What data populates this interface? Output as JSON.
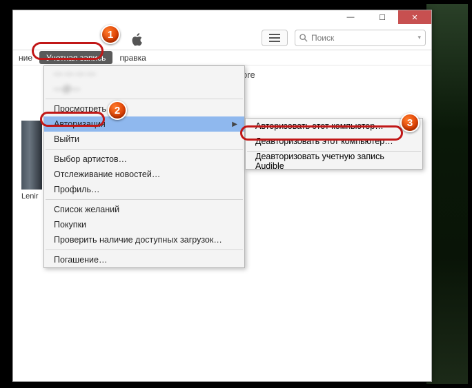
{
  "window": {
    "minimize": "—",
    "maximize": "☐",
    "close": "✕"
  },
  "search": {
    "placeholder": "Поиск"
  },
  "menubar": {
    "item_left_fragment": "ние",
    "account": "Учетная запись",
    "help": "правка"
  },
  "store_fragment": "ore",
  "album_caption": "Lenir",
  "dropdown": {
    "blur1": "— — — —",
    "blur2": "—@—",
    "view": "Просмотреть",
    "authorization": "Авторизация",
    "signout": "Выйти",
    "artist_select": "Выбор артистов…",
    "news_tracking": "Отслеживание новостей…",
    "profile": "Профиль…",
    "wishlist": "Список желаний",
    "purchases": "Покупки",
    "check_downloads": "Проверить наличие доступных загрузок…",
    "redemption": "Погашение…"
  },
  "submenu": {
    "authorize": "Авторизовать этот компьютер…",
    "deauthorize": "Деавторизовать этот компьютер…",
    "deauth_audible": "Деавторизовать учетную запись Audible"
  },
  "badges": {
    "b1": "1",
    "b2": "2",
    "b3": "3"
  }
}
